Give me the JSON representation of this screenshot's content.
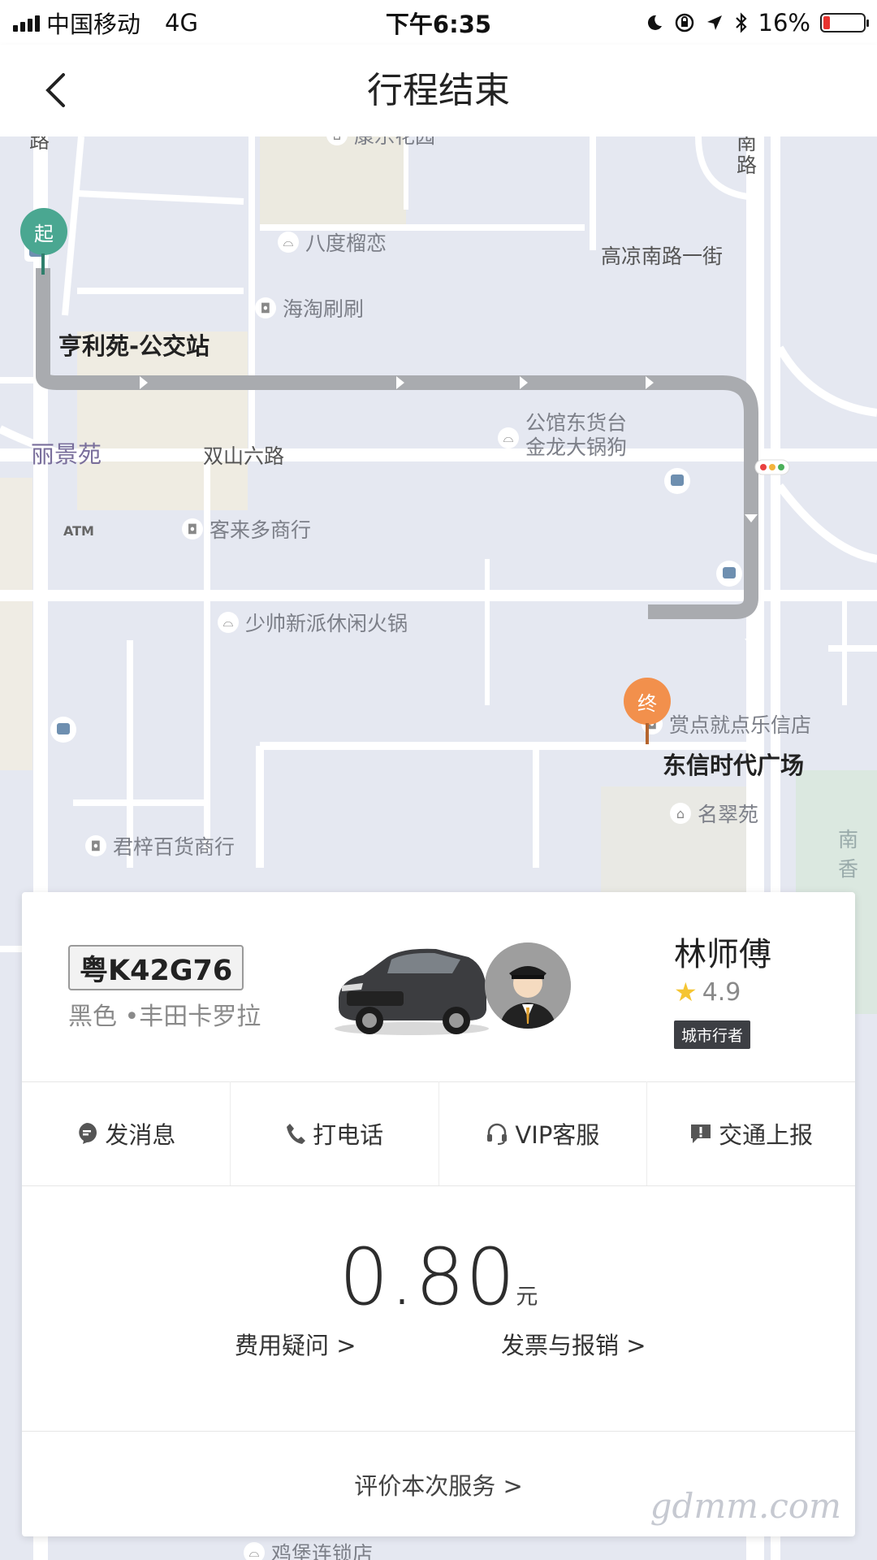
{
  "status_bar": {
    "carrier": "中国移动",
    "network": "4G",
    "time": "下午6:35",
    "battery_percent": "16%",
    "battery_level": 0.16
  },
  "nav": {
    "title": "行程结束"
  },
  "map": {
    "pois": [
      "康乐花园",
      "八度榴恋",
      "海淘刷刷",
      "公馆东货台",
      "金龙大锅狗",
      "客来多商行",
      "少帅新派休闲火锅",
      "赏点就点乐信店",
      "名翠苑",
      "君梓百货商行",
      "鸡堡连锁店"
    ],
    "roads": [
      "高凉南路一街",
      "双山六路",
      "丽景苑",
      "路",
      "南路"
    ],
    "start_label": "亨利苑-公交站",
    "end_label": "东信时代广场",
    "start_pin": "起",
    "end_pin": "终",
    "atm": "ATM",
    "edge_text": "南香"
  },
  "trip_card": {
    "plate": "粤K42G76",
    "car_desc": "黑色 •丰田卡罗拉",
    "driver_name": "林师傅",
    "rating": "4.9",
    "badge": "城市行者",
    "actions": [
      {
        "label": "发消息",
        "icon": "message-icon"
      },
      {
        "label": "打电话",
        "icon": "phone-icon"
      },
      {
        "label": "VIP客服",
        "icon": "headset-icon"
      },
      {
        "label": "交通上报",
        "icon": "report-icon"
      }
    ],
    "fare_amount": "0.80",
    "fare_unit": "元",
    "fare_question": "费用疑问 >",
    "invoice": "发票与报销 >",
    "rate_service": "评价本次服务 >"
  },
  "colors": {
    "start_pin": "#4aa791",
    "end_pin": "#f2904c",
    "route": "#a9abaf"
  },
  "watermark": "gdmm.com"
}
